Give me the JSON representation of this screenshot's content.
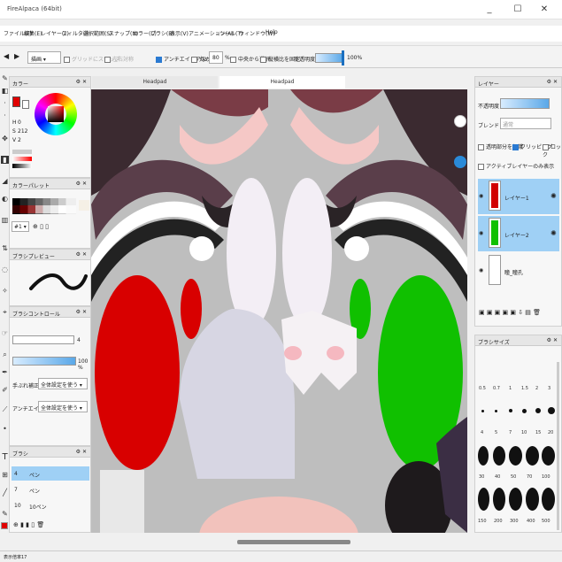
{
  "window": {
    "title": "FireAlpaca (64bit)",
    "minimize": "_",
    "maximize": "☐",
    "close": "✕"
  },
  "menu": [
    "ファイル(F)",
    "編集(E)",
    "レイヤー(L)",
    "フィルタ(I)",
    "選択範囲(S)",
    "スナップ(N)",
    "カラー(C)",
    "ブラシ(B)",
    "表示(V)",
    "アニメーション(A)",
    "ツール(T)",
    "ウィンドウ(W)",
    "Help"
  ],
  "toolbar": {
    "mode": "描画",
    "grid_snap": "グリッドにスナップ",
    "grid_select": "左右対称",
    "antialias": "アンチエイリアス",
    "radius": "丸める",
    "radius_value": "80",
    "radius_unit": "%",
    "center": "中央から選択",
    "fixed_ratio": "縦横比を固定",
    "opacity_label": "不透明度",
    "opacity_value": "100%"
  },
  "tabs": [
    "Headpad",
    "Headpad"
  ],
  "color_panel": {
    "title": "カラー",
    "h": "H",
    "s": "S",
    "v": "V",
    "h_val": "0",
    "s_val": "212",
    "v_val": "2",
    "fg": "#e00000",
    "bg": "#ffffff"
  },
  "palette_panel": {
    "title": "カラーパレット",
    "name": "#1"
  },
  "brush_preview": {
    "title": "ブラシプレビュー"
  },
  "brush_control": {
    "title": "ブラシコントロール",
    "size_value": "4",
    "opacity_value": "100 %",
    "correction_label": "手ぶれ補正",
    "correction_value": "全体設定を使う",
    "aa_label": "アンチエイリアス",
    "aa_value": "全体設定を使う"
  },
  "brush_list": {
    "title": "ブラシ",
    "items": [
      {
        "size": "4",
        "name": "ペン"
      },
      {
        "size": "7",
        "name": "ペン"
      },
      {
        "size": "10",
        "name": "10ペン"
      }
    ]
  },
  "layer_panel": {
    "title": "レイヤー",
    "opacity_label": "不透明度",
    "blend_label": "ブレンド",
    "blend_value": "通常",
    "protect_alpha": "透明部分を保護",
    "clipping": "クリッピング",
    "lock": "ロック",
    "active_only": "アクティブレイヤーのみ表示",
    "layers": [
      {
        "name": "レイヤー1",
        "color": "#d10000"
      },
      {
        "name": "レイヤー2",
        "color": "#10c000"
      },
      {
        "name": "瞳_瞳孔"
      }
    ]
  },
  "brush_size_panel": {
    "title": "ブラシサイズ",
    "row1": [
      "0.5",
      "0.7",
      "1",
      "1.5",
      "2",
      "3"
    ],
    "row2": [
      "4",
      "5",
      "7",
      "10",
      "15",
      "20"
    ],
    "row3": [
      "30",
      "40",
      "50",
      "70",
      "100"
    ],
    "row4": [
      "150",
      "200",
      "300",
      "400",
      "500"
    ]
  },
  "status": {
    "text": "表示倍率17"
  }
}
